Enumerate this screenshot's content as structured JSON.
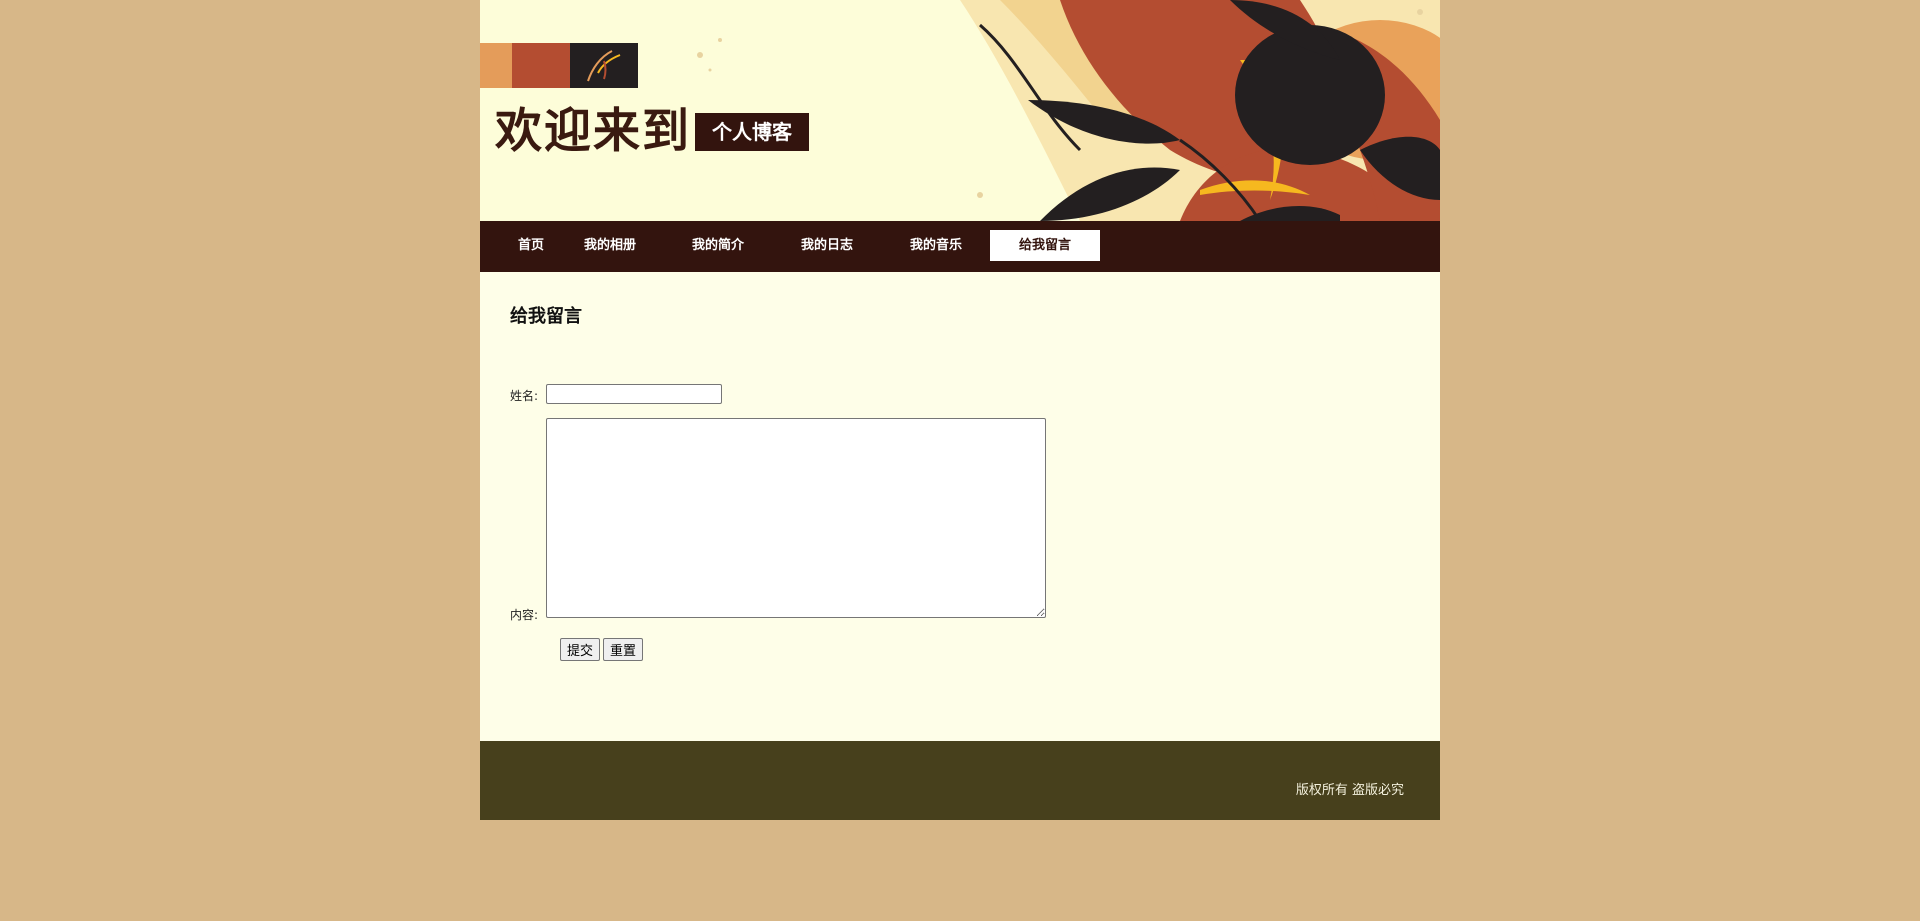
{
  "header": {
    "welcome_text": "欢迎来到",
    "blog_badge": "个人博客"
  },
  "nav": {
    "items": [
      {
        "label": "首页"
      },
      {
        "label": "我的相册"
      },
      {
        "label": "我的简介"
      },
      {
        "label": "我的日志"
      },
      {
        "label": "我的音乐"
      },
      {
        "label": "给我留言",
        "active": true
      }
    ]
  },
  "main": {
    "title": "给我留言",
    "form": {
      "name_label": "姓名:",
      "name_value": "",
      "content_label": "内容:",
      "content_value": "",
      "submit_label": "提交",
      "reset_label": "重置"
    }
  },
  "footer": {
    "copyright": "版权所有  盗版必究"
  },
  "colors": {
    "page_bg": "#d7b788",
    "nav_bg": "#33140e",
    "footer_bg": "#47401c",
    "content_bg": "#fefee8",
    "accent_orange": "#b44d31"
  }
}
